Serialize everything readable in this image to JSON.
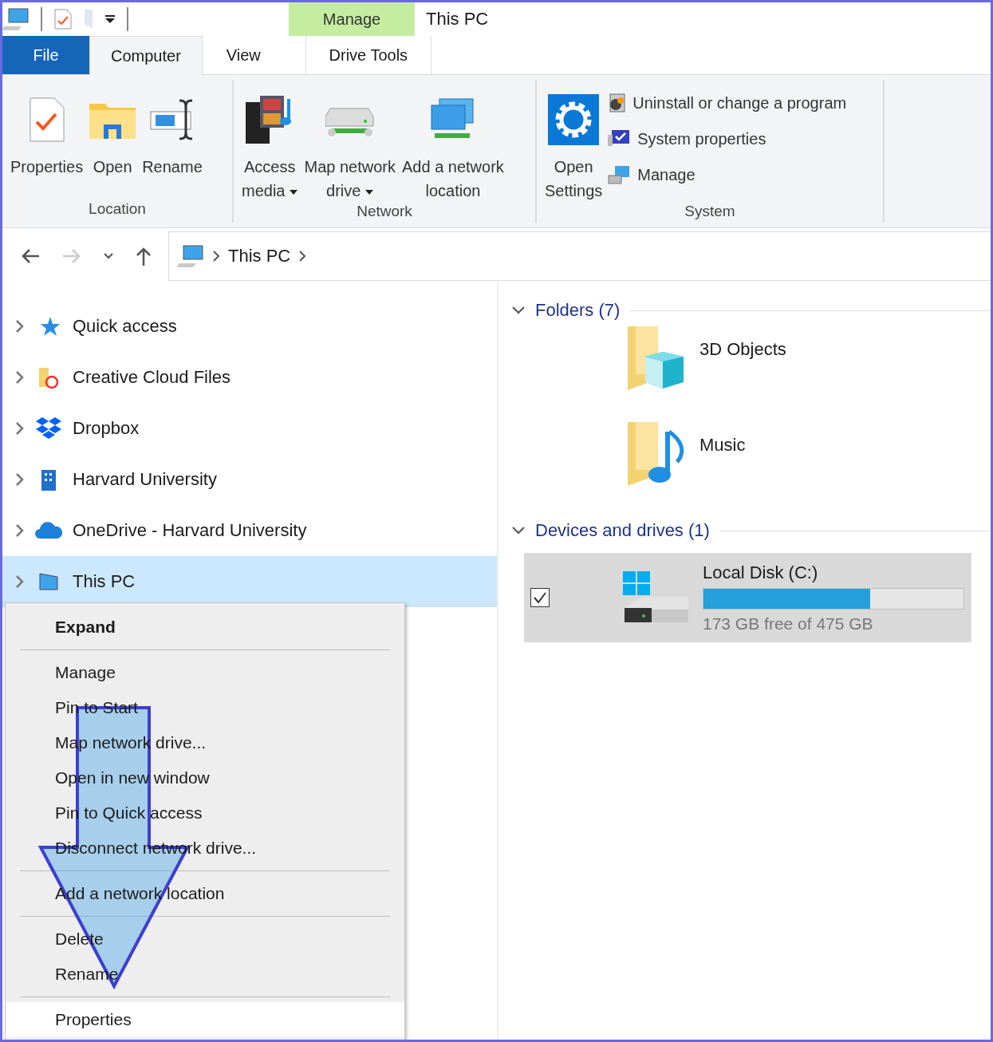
{
  "window": {
    "title": "This PC"
  },
  "context_tab": {
    "label": "Manage"
  },
  "tabs": [
    {
      "label": "File",
      "kind": "file",
      "selected": false
    },
    {
      "label": "Computer",
      "kind": "tab",
      "selected": true
    },
    {
      "label": "View",
      "kind": "tab",
      "selected": false
    },
    {
      "label": "Drive Tools",
      "kind": "contextual",
      "selected": false
    }
  ],
  "ribbon": {
    "groups": [
      {
        "label": "Location",
        "buttons": [
          {
            "kind": "large",
            "lines": [
              "Properties"
            ],
            "dropdown": false
          },
          {
            "kind": "large",
            "lines": [
              "Open"
            ],
            "dropdown": false
          },
          {
            "kind": "large",
            "lines": [
              "Rename"
            ],
            "dropdown": false
          }
        ]
      },
      {
        "label": "Network",
        "buttons": [
          {
            "kind": "large",
            "lines": [
              "Access",
              "media"
            ],
            "dropdown": true
          },
          {
            "kind": "large",
            "lines": [
              "Map network",
              "drive"
            ],
            "dropdown": true
          },
          {
            "kind": "large",
            "lines": [
              "Add a network",
              "location"
            ],
            "dropdown": false
          }
        ]
      },
      {
        "label": "System",
        "buttons": [
          {
            "kind": "large",
            "lines": [
              "Open",
              "Settings"
            ],
            "dropdown": false
          },
          {
            "kind": "small",
            "lines": [
              "Uninstall or change a program"
            ],
            "dropdown": false
          },
          {
            "kind": "small",
            "lines": [
              "System properties"
            ],
            "dropdown": false
          },
          {
            "kind": "small",
            "lines": [
              "Manage"
            ],
            "dropdown": false
          }
        ]
      }
    ]
  },
  "address": {
    "crumbs": [
      "This PC"
    ]
  },
  "nav_tree": [
    {
      "label": "Quick access",
      "selected": false
    },
    {
      "label": "Creative Cloud Files",
      "selected": false
    },
    {
      "label": "Dropbox",
      "selected": false
    },
    {
      "label": "Harvard University",
      "selected": false
    },
    {
      "label": "OneDrive - Harvard University",
      "selected": false
    },
    {
      "label": "This PC",
      "selected": true
    }
  ],
  "sections": [
    {
      "title": "Folders (7)",
      "kind": "folders",
      "items": [
        {
          "name": "3D Objects"
        },
        {
          "name": "Music"
        }
      ]
    },
    {
      "title": "Devices and drives (1)",
      "kind": "drives",
      "items": [
        {
          "name": "Local Disk (C:)",
          "level": 0.64,
          "free": "173 GB free of 475 GB",
          "checked": true,
          "selected": true
        }
      ]
    }
  ],
  "context_menu": {
    "groups": [
      [
        {
          "label": "Expand",
          "bold": true,
          "highlighted": false
        }
      ],
      [
        {
          "label": "Manage",
          "bold": false,
          "highlighted": false
        },
        {
          "label": "Pin to Start",
          "bold": false,
          "highlighted": false
        },
        {
          "label": "Map network drive...",
          "bold": false,
          "highlighted": false
        },
        {
          "label": "Open in new window",
          "bold": false,
          "highlighted": false
        },
        {
          "label": "Pin to Quick access",
          "bold": false,
          "highlighted": false
        },
        {
          "label": "Disconnect network drive...",
          "bold": false,
          "highlighted": false
        }
      ],
      [
        {
          "label": "Add a network location",
          "bold": false,
          "highlighted": false
        }
      ],
      [
        {
          "label": "Delete",
          "bold": false,
          "highlighted": false
        },
        {
          "label": "Rename",
          "bold": false,
          "highlighted": false
        }
      ],
      [
        {
          "label": "Properties",
          "bold": false,
          "highlighted": true
        }
      ]
    ]
  }
}
